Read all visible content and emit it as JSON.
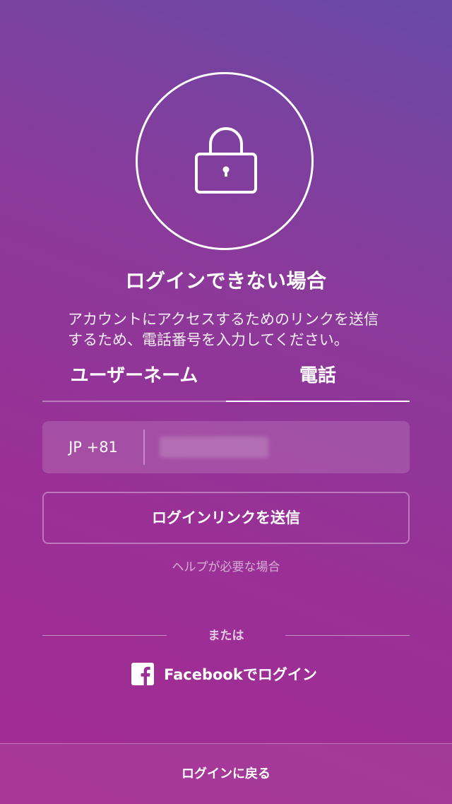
{
  "header": {
    "icon": "lock-icon",
    "title": "ログインできない場合",
    "description": "アカウントにアクセスするためのリンクを送信するため、電話番号を入力してください。"
  },
  "tabs": [
    {
      "label": "ユーザーネーム",
      "active": false
    },
    {
      "label": "電話",
      "active": true
    }
  ],
  "phone": {
    "country_code": "JP +81",
    "value": ""
  },
  "actions": {
    "send_link": "ログインリンクを送信",
    "help": "ヘルプが必要な場合",
    "or": "または",
    "facebook_login": "Facebookでログイン",
    "back_to_login": "ログインに戻る"
  },
  "colors": {
    "gradient_top_right": "#6a49a6",
    "gradient_bottom_left": "#a32b92",
    "text": "#ffffff"
  }
}
